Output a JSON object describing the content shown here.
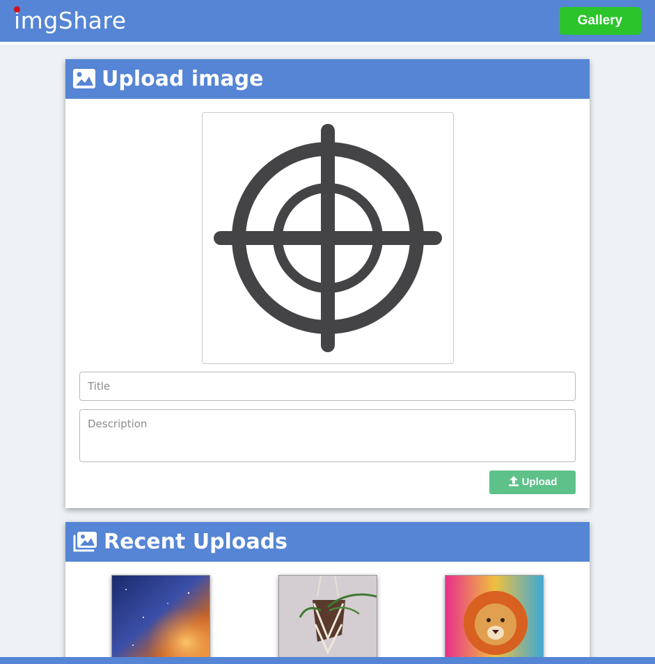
{
  "nav": {
    "brand": "imgShare",
    "gallery_label": "Gallery",
    "colors": {
      "bar": "#5585d4",
      "gallery": "#2bc42b",
      "dot": "#d4101c"
    }
  },
  "upload": {
    "heading": "Upload image",
    "heading_icon": "image-icon",
    "preview_icon": "crosshair-icon",
    "title_placeholder": "Title",
    "description_placeholder": "Description",
    "upload_label": "Upload",
    "upload_icon": "upload-icon"
  },
  "recent": {
    "heading": "Recent Uploads",
    "heading_icon": "images-icon",
    "thumbnails": [
      {
        "subject": "galaxy-nebula"
      },
      {
        "subject": "hanging-plant"
      },
      {
        "subject": "colorful-lion"
      }
    ]
  }
}
